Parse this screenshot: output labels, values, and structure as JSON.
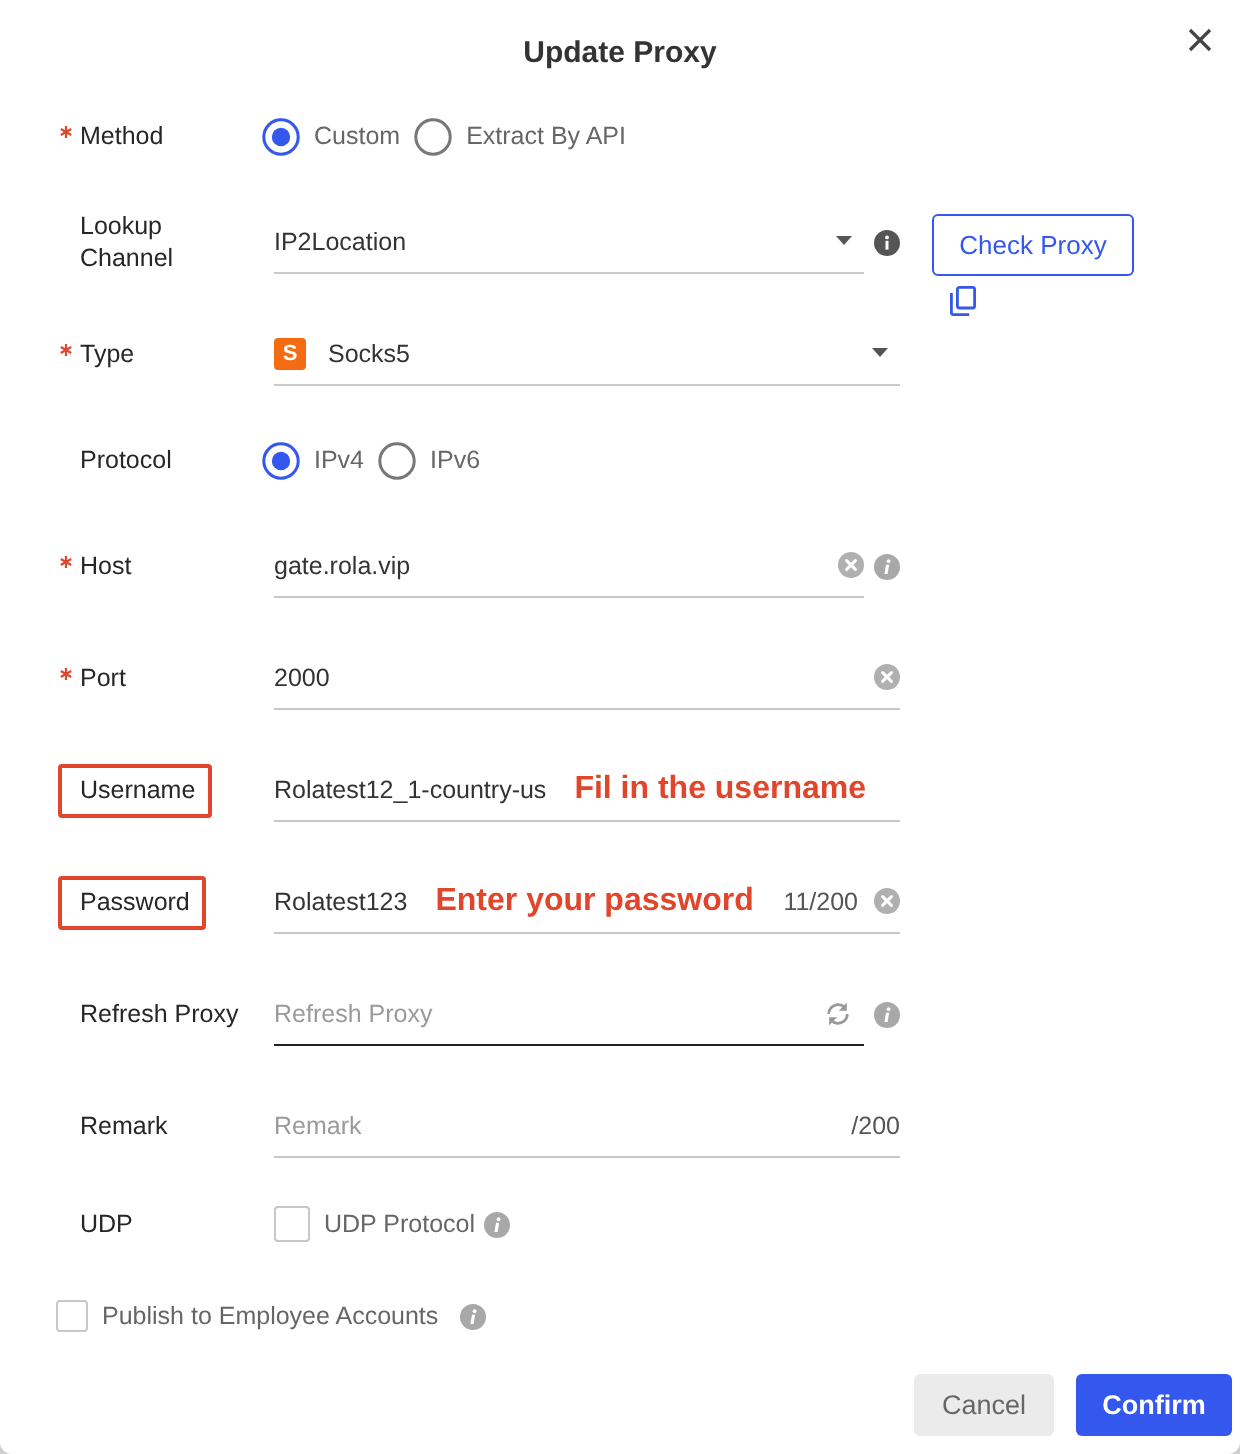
{
  "dialog": {
    "title": "Update Proxy"
  },
  "fields": [
    {
      "kind": "radio",
      "label": "Method",
      "required": true,
      "highlighted": false,
      "options": [
        {
          "label": "Custom",
          "selected": true
        },
        {
          "label": "Extract By API",
          "selected": false
        }
      ]
    },
    {
      "kind": "select",
      "label": "Lookup Channel",
      "required": false,
      "highlighted": false,
      "value": "IP2Location",
      "info": {
        "kind": "solid"
      },
      "action": {
        "label": "Check Proxy"
      }
    },
    {
      "kind": "select",
      "label": "Type",
      "required": true,
      "highlighted": false,
      "badge": "S",
      "value": "Socks5"
    },
    {
      "kind": "radio",
      "label": "Protocol",
      "required": false,
      "highlighted": false,
      "options": [
        {
          "label": "IPv4",
          "selected": true
        },
        {
          "label": "IPv6",
          "selected": false
        }
      ]
    },
    {
      "kind": "input",
      "label": "Host",
      "required": true,
      "highlighted": false,
      "focused": false,
      "value": "gate.rola.vip",
      "clearable": true,
      "info": {
        "kind": "italic"
      }
    },
    {
      "kind": "input",
      "label": "Port",
      "required": true,
      "highlighted": false,
      "focused": false,
      "value": "2000",
      "clearable": true
    },
    {
      "kind": "input",
      "label": "Username",
      "required": false,
      "highlighted": true,
      "focused": false,
      "value": "Rolatest12_1-country-us",
      "annotation": "Fil in the username"
    },
    {
      "kind": "input",
      "label": "Password",
      "required": false,
      "highlighted": true,
      "focused": false,
      "value": "Rolatest123",
      "annotation": "Enter your password",
      "count": "11/200",
      "clearable": true
    },
    {
      "kind": "input",
      "label": "Refresh Proxy",
      "required": false,
      "highlighted": false,
      "focused": true,
      "placeholder": "Refresh Proxy",
      "refresh": true,
      "info": {
        "kind": "italic"
      }
    },
    {
      "kind": "input",
      "label": "Remark",
      "required": false,
      "highlighted": false,
      "focused": false,
      "placeholder": "Remark",
      "count": "/200"
    },
    {
      "kind": "checkbox",
      "label": "UDP",
      "required": false,
      "highlighted": false,
      "checked": false,
      "text": "UDP Protocol",
      "info": {
        "kind": "italic"
      }
    }
  ],
  "publish": {
    "label": "Publish to Employee Accounts",
    "checked": false,
    "info": {
      "kind": "italic"
    }
  },
  "buttons": [
    {
      "label": "Cancel",
      "kind": "secondary"
    },
    {
      "label": "Confirm",
      "kind": "primary"
    }
  ]
}
